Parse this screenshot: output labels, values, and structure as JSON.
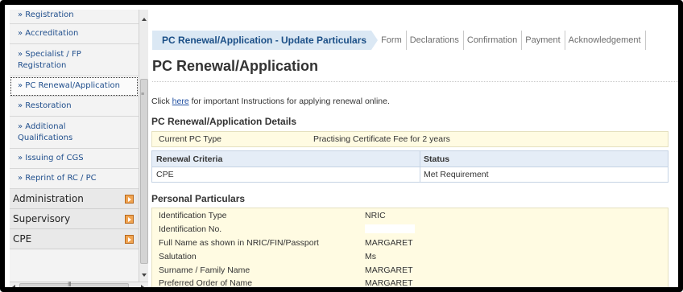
{
  "sidebar": {
    "items": [
      {
        "label": "» Registration"
      },
      {
        "label": "» Accreditation"
      },
      {
        "label": "» Specialist / FP Registration"
      },
      {
        "label": "» PC Renewal/Application"
      },
      {
        "label": "» Restoration"
      },
      {
        "label": "» Additional Qualifications"
      },
      {
        "label": "» Issuing of CGS"
      },
      {
        "label": "» Reprint of RC / PC"
      }
    ],
    "groups": [
      {
        "label": "Administration"
      },
      {
        "label": "Supervisory"
      },
      {
        "label": "CPE"
      }
    ]
  },
  "breadcrumb": {
    "steps": [
      "PC Renewal/Application - Update Particulars",
      "Form",
      "Declarations",
      "Confirmation",
      "Payment",
      "Acknowledgement"
    ]
  },
  "page": {
    "title": "PC Renewal/Application",
    "instruction_prefix": "Click ",
    "instruction_link": "here",
    "instruction_suffix": " for important Instructions for applying renewal online."
  },
  "details": {
    "heading": "PC Renewal/Application Details",
    "current_pc_type_label": "Current PC Type",
    "current_pc_type_value": "Practising Certificate Fee for 2 years",
    "criteria_header": "Renewal Criteria",
    "status_header": "Status",
    "criteria_rows": [
      {
        "criteria": "CPE",
        "status": "Met Requirement"
      }
    ]
  },
  "personal": {
    "heading": "Personal Particulars",
    "rows": [
      {
        "label": "Identification Type",
        "value": "NRIC"
      },
      {
        "label": "Identification No.",
        "value": ""
      },
      {
        "label": "Full Name as shown in NRIC/FIN/Passport",
        "value": "MARGARET"
      },
      {
        "label": "Salutation",
        "value": "Ms"
      },
      {
        "label": "Surname / Family Name",
        "value": "MARGARET"
      },
      {
        "label": "Preferred Order of Name",
        "value": "MARGARET"
      }
    ]
  },
  "colors": {
    "active_step_bg": "#dbe8f4",
    "link": "#1f4ea0",
    "nav_link": "#1f4e8c",
    "info_box_bg": "#fffbe2",
    "expand_icon": "#f0a350"
  }
}
